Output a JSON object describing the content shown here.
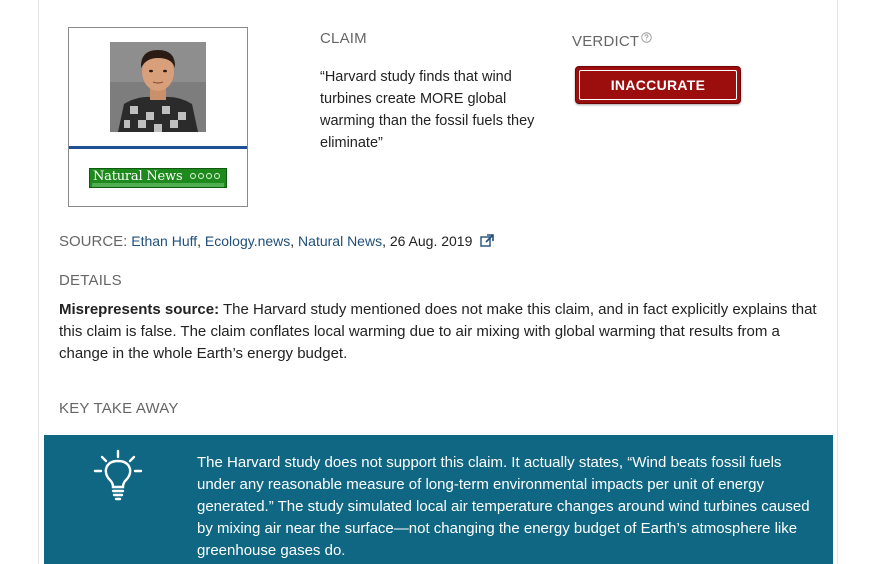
{
  "claim_section": {
    "label": "CLAIM",
    "text": "“Harvard study finds that wind turbines create MORE global warming than the fossil fuels they eliminate”"
  },
  "verdict_section": {
    "label": "VERDICT",
    "help_icon": "question-circle-icon",
    "badge": "INACCURATE",
    "badge_color": "#9c0d0d"
  },
  "outlet_logo": {
    "name": "Natural News"
  },
  "source": {
    "label": "SOURCE:",
    "author": "Ethan Huff",
    "sep1": ", ",
    "site1": "Ecology.news",
    "sep2": ", ",
    "site2": "Natural News",
    "date": ", 26 Aug. 2019",
    "link_icon": "external-link-icon"
  },
  "details": {
    "label": "DETAILS",
    "lead": "Misrepresents source:",
    "text": " The Harvard study mentioned does not make this claim, and in fact explicitly explains that this claim is false. The claim conflates local warming due to air mixing with global warming that results from a change in the whole Earth’s energy budget."
  },
  "key_takeaway": {
    "label": "KEY TAKE AWAY",
    "icon": "lightbulb-icon",
    "text": "The Harvard study does not support this claim. It actually states, “Wind beats fossil fuels under any reasonable measure of long-term environmental impacts per unit of energy generated.” The study simulated local air temperature changes around wind turbines caused by mixing air near the surface—not changing the energy budget of Earth’s atmosphere like greenhouse gases do.",
    "background_color": "#0f6784"
  }
}
